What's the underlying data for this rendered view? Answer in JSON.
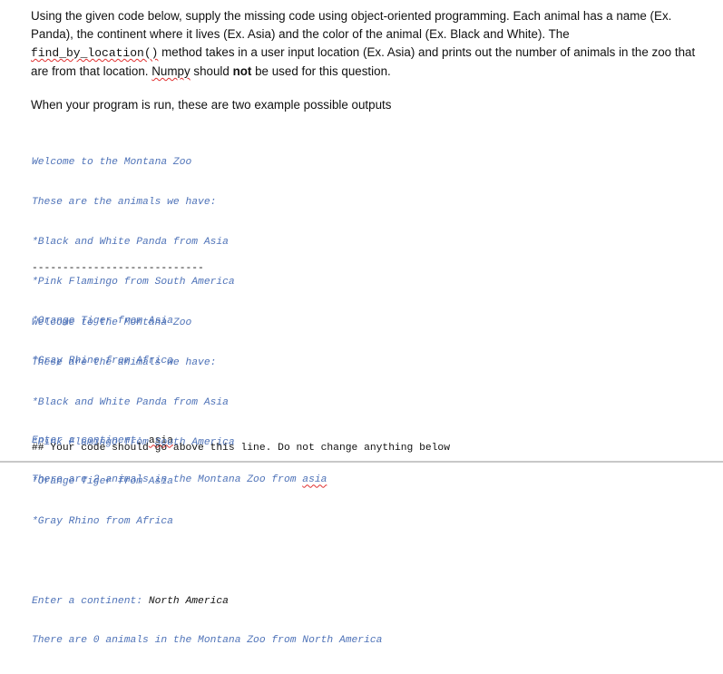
{
  "question": {
    "p1_a": "Using the given code below, supply the missing code using object-oriented programming. Each animal has a name (Ex. Panda), the continent where it lives (Ex. Asia) and the color of the animal (Ex. Black and White). The",
    "method_name": "find_by_location()",
    "p1_b": " method takes in a user input location (Ex. Asia) and prints out the number of animals in the zoo that are from that location. ",
    "numpy": "Numpy",
    "p1_c": " should ",
    "not": "not",
    "p1_d": " be used for this question."
  },
  "intro": "When your program is run, these are two example possible outputs",
  "example1": {
    "lines": [
      "Welcome to the Montana Zoo",
      "These are the animals we have:",
      "*Black and White Panda from Asia",
      "*Pink Flamingo from South America",
      "*Orange Tiger from Asia",
      "*Gray Rhino from Africa"
    ],
    "prompt": "Enter a continent: ",
    "input": "asia",
    "result_prefix": "There are 2 animals in the Montana Zoo from ",
    "result_location": "asia"
  },
  "separator": "----------------------------",
  "example2": {
    "lines": [
      "Welcome to the Montana Zoo",
      "These are the animals we have:",
      "*Black and White Panda from Asia",
      "*Pink Flamingo from South America",
      "*Orange Tiger from Asia",
      "*Gray Rhino from Africa"
    ],
    "prompt": "Enter a continent: ",
    "input": "North America",
    "result": "There are 0 animals in the Montana Zoo from North America"
  },
  "footer": "## Your code should go above this line. Do not change anything below"
}
